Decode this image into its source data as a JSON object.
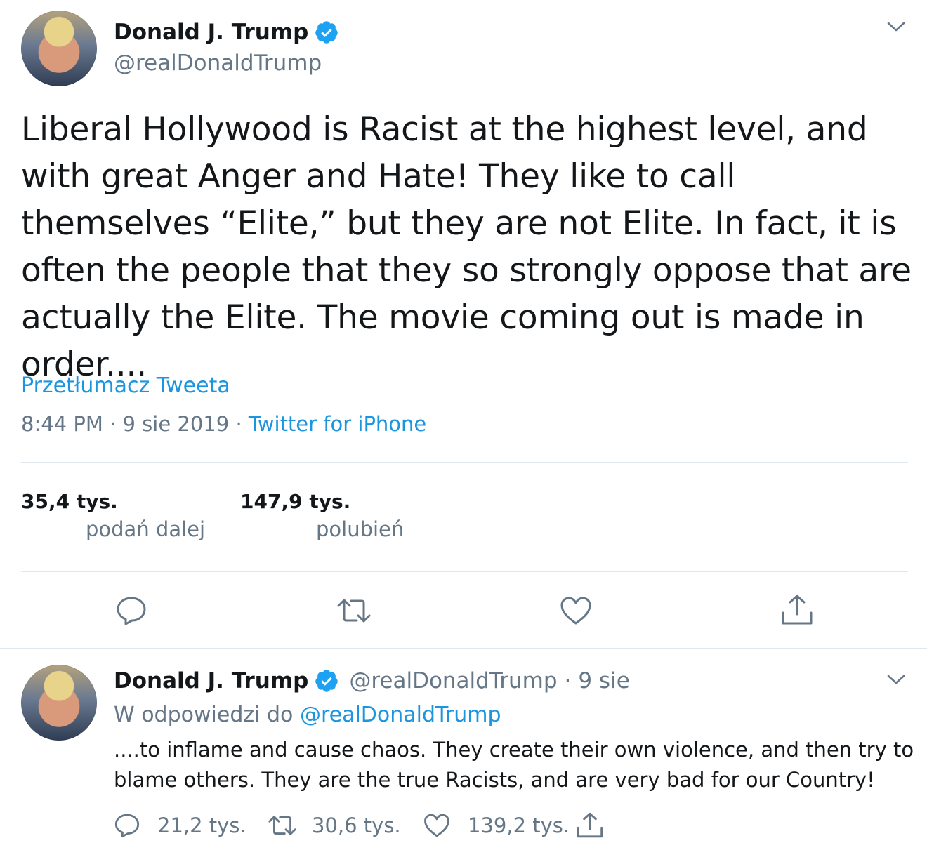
{
  "main_tweet": {
    "author": {
      "name": "Donald J. Trump",
      "handle": "@realDonaldTrump"
    },
    "text": "Liberal Hollywood is Racist at the highest level, and with great Anger and Hate! They like to call themselves “Elite,” but they are not Elite. In fact, it is often the people that they so strongly oppose that are actually the Elite. The movie coming out is made in order....",
    "translate_label": "Przetłumacz Tweeta",
    "time": "8:44 PM",
    "date": "9 sie 2019",
    "separator": "·",
    "source": "Twitter for iPhone",
    "stats": {
      "retweets_count": "35,4 tys.",
      "retweets_label": "podań dalej",
      "likes_count": "147,9 tys.",
      "likes_label": "polubień"
    }
  },
  "reply_tweet": {
    "author": {
      "name": "Donald J. Trump",
      "handle": "@realDonaldTrump"
    },
    "separator": "·",
    "date": "9 sie",
    "in_reply_prefix": "W odpowiedzi do",
    "in_reply_handle": "@realDonaldTrump",
    "text": "....to inflame and cause chaos. They create their own violence, and then try to blame others. They are the true Racists, and are very bad for our Country!",
    "counts": {
      "replies": "21,2 tys.",
      "retweets": "30,6 tys.",
      "likes": "139,2 tys."
    }
  },
  "colors": {
    "accent": "#1b95e0",
    "muted": "#657786",
    "text": "#14171a",
    "divider": "#e1e8ed"
  },
  "icons": [
    "verified-badge-icon",
    "chevron-down-icon",
    "reply-icon",
    "retweet-icon",
    "like-icon",
    "share-icon"
  ]
}
